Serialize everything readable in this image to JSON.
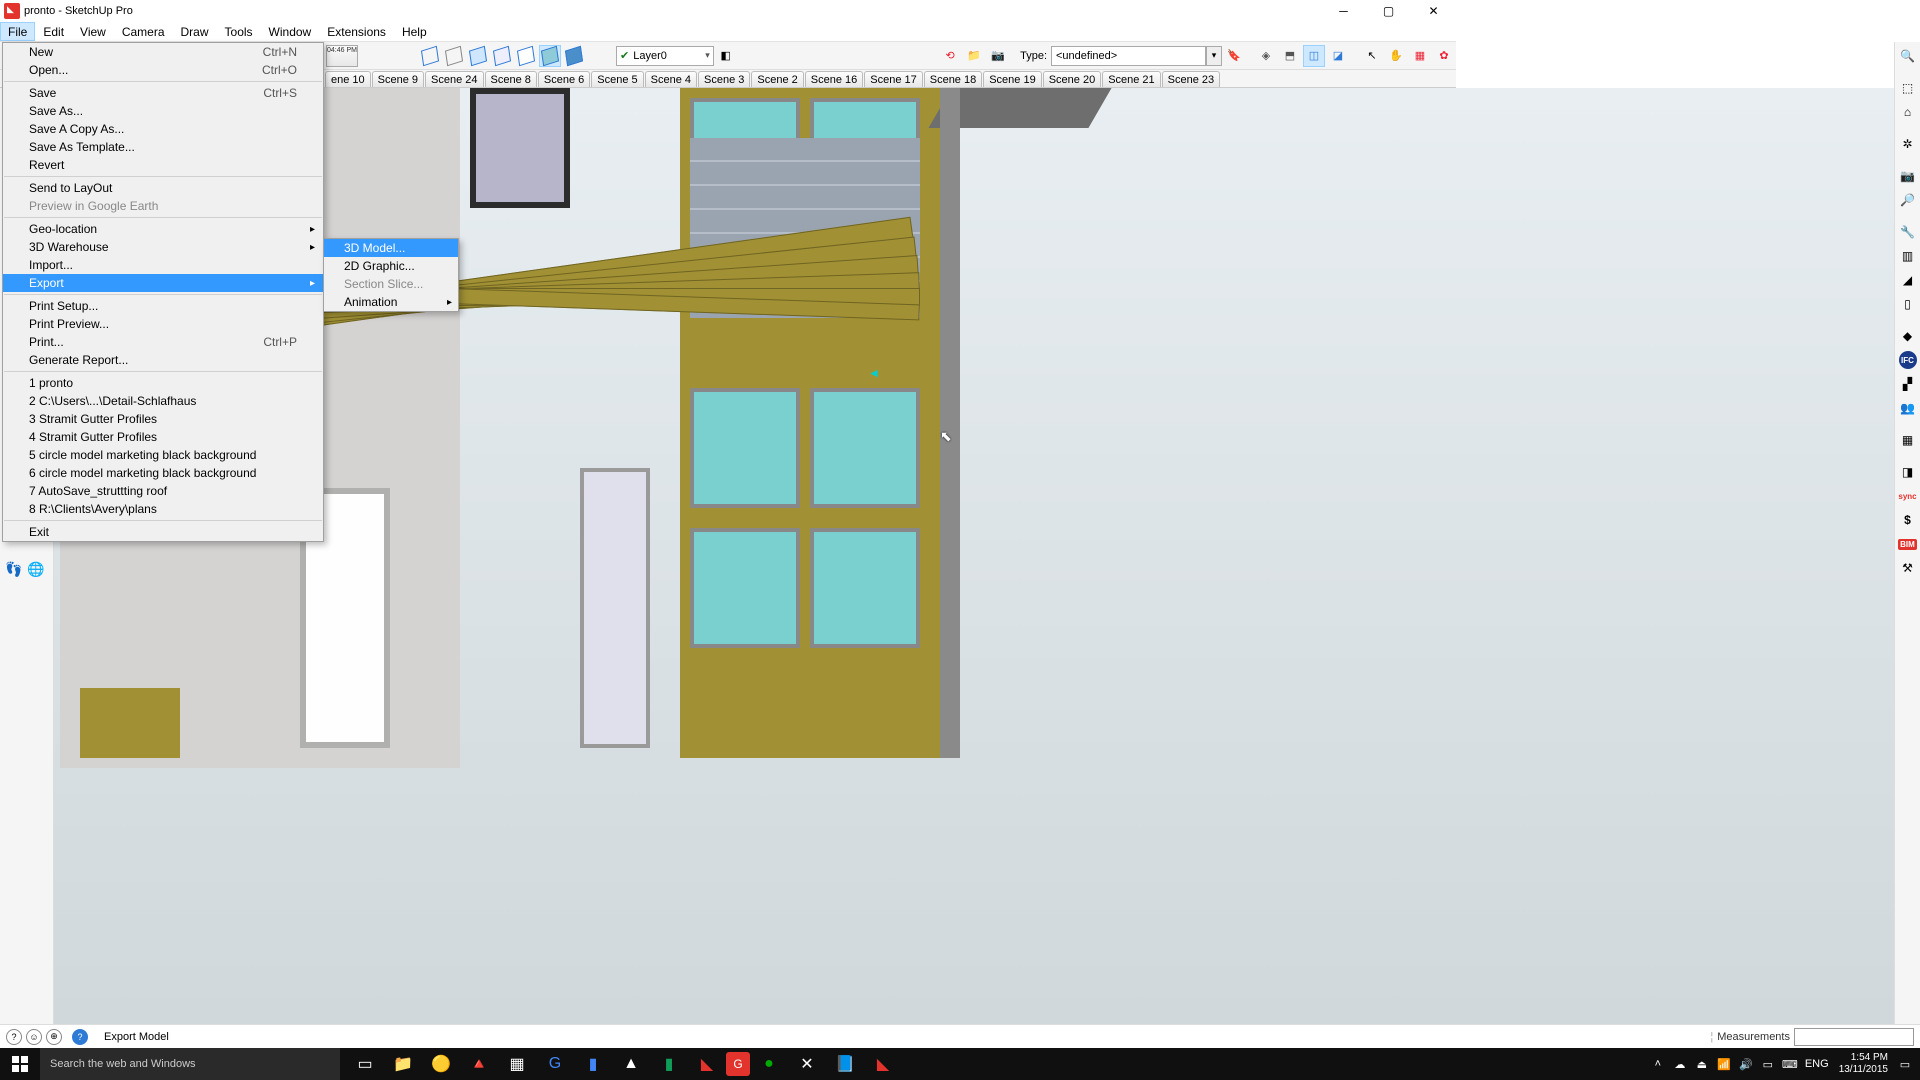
{
  "window": {
    "title": "pronto - SketchUp Pro"
  },
  "menubar": [
    "File",
    "Edit",
    "View",
    "Camera",
    "Draw",
    "Tools",
    "Window",
    "Extensions",
    "Help"
  ],
  "toolbar": {
    "clock_time": "04:46 PM",
    "layer_label": "Layer0",
    "type_prefix": "Type:",
    "type_value": "<undefined>"
  },
  "scenes": [
    "ene 10",
    "Scene 9",
    "Scene 24",
    "Scene 8",
    "Scene 6",
    "Scene 5",
    "Scene 4",
    "Scene 3",
    "Scene 2",
    "Scene 16",
    "Scene 17",
    "Scene 18",
    "Scene 19",
    "Scene 20",
    "Scene 21",
    "Scene 23"
  ],
  "file_menu": {
    "groups": [
      [
        {
          "label": "New",
          "shortcut": "Ctrl+N"
        },
        {
          "label": "Open...",
          "shortcut": "Ctrl+O"
        }
      ],
      [
        {
          "label": "Save",
          "shortcut": "Ctrl+S"
        },
        {
          "label": "Save As..."
        },
        {
          "label": "Save A Copy As..."
        },
        {
          "label": "Save As Template..."
        },
        {
          "label": "Revert"
        }
      ],
      [
        {
          "label": "Send to LayOut"
        },
        {
          "label": "Preview in Google Earth",
          "disabled": true
        }
      ],
      [
        {
          "label": "Geo-location",
          "submenu": true
        },
        {
          "label": "3D Warehouse",
          "submenu": true
        },
        {
          "label": "Import..."
        },
        {
          "label": "Export",
          "submenu": true,
          "hover": true
        }
      ],
      [
        {
          "label": "Print Setup..."
        },
        {
          "label": "Print Preview..."
        },
        {
          "label": "Print...",
          "shortcut": "Ctrl+P"
        },
        {
          "label": "Generate Report..."
        }
      ],
      [
        {
          "label": "1 pronto"
        },
        {
          "label": "2 C:\\Users\\...\\Detail-Schlafhaus"
        },
        {
          "label": "3 Stramit Gutter Profiles"
        },
        {
          "label": "4 Stramit Gutter Profiles"
        },
        {
          "label": "5 circle model marketing black background"
        },
        {
          "label": "6 circle model marketing black background"
        },
        {
          "label": "7 AutoSave_struttting roof"
        },
        {
          "label": "8 R:\\Clients\\Avery\\plans"
        }
      ],
      [
        {
          "label": "Exit"
        }
      ]
    ]
  },
  "export_submenu": [
    {
      "label": "3D Model...",
      "hover": true
    },
    {
      "label": "2D Graphic..."
    },
    {
      "label": "Section Slice...",
      "disabled": true
    },
    {
      "label": "Animation",
      "submenu": true
    }
  ],
  "status": {
    "hint": "Export Model",
    "measurements_label": "Measurements"
  },
  "right_rail_sync": "sync",
  "right_rail_bim": "BIM",
  "right_rail_ifc": "IFC",
  "taskbar": {
    "search_placeholder": "Search the web and Windows",
    "lang": "ENG",
    "time": "1:54 PM",
    "date": "13/11/2015"
  }
}
